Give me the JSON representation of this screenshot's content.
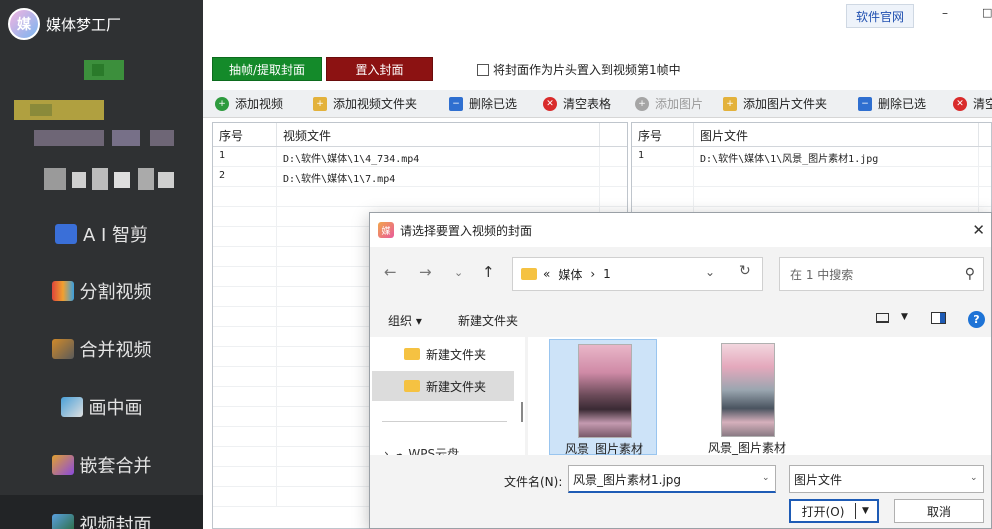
{
  "app": {
    "title": "媒体梦工厂",
    "logo_char": "媒"
  },
  "window": {
    "website_label": "软件官网",
    "minimize_glyph": "–",
    "maximize_glyph": "□"
  },
  "sidebar": {
    "items": [
      {
        "label": "A I 智剪",
        "icon": "ai-cut-icon",
        "color": "#3a6fd8"
      },
      {
        "label": "分割视频",
        "icon": "split-video-icon",
        "color": "#e0463a"
      },
      {
        "label": "合并视频",
        "icon": "merge-video-icon",
        "color": "#d08a2a"
      },
      {
        "label": "画中画",
        "icon": "picture-in-picture-icon",
        "color": "#4aa0d8"
      },
      {
        "label": "嵌套合并",
        "icon": "nested-merge-icon",
        "color": "#e0a030"
      },
      {
        "label": "视频封面",
        "icon": "video-cover-icon",
        "color": "#5aa0e0"
      }
    ]
  },
  "actions": {
    "extract_label": "抽帧/提取封面",
    "insert_label": "置入封面",
    "cover_checkbox_label": "将封面作为片头置入到视频第1帧中"
  },
  "toolbar": {
    "items": [
      {
        "label": "添加视频",
        "icon": "add-circle-icon",
        "color": "#2e9b3e"
      },
      {
        "label": "添加视频文件夹",
        "icon": "folder-add-icon",
        "color": "#e3b23c"
      },
      {
        "label": "删除已选",
        "icon": "delete-selected-icon",
        "color": "#2f6fd0"
      },
      {
        "label": "清空表格",
        "icon": "clear-icon",
        "color": "#d92b2b"
      },
      {
        "label": "添加图片",
        "icon": "add-circle-icon",
        "color": "#9a9a9a"
      },
      {
        "label": "添加图片文件夹",
        "icon": "folder-add-icon",
        "color": "#e3b23c"
      },
      {
        "label": "删除已选",
        "icon": "delete-selected-icon",
        "color": "#2f6fd0"
      },
      {
        "label": "清空",
        "icon": "clear-icon",
        "color": "#d92b2b"
      }
    ]
  },
  "video_table": {
    "headers": [
      "序号",
      "视频文件"
    ],
    "rows": [
      [
        "1",
        "D:\\软件\\媒体\\1\\4_734.mp4"
      ],
      [
        "2",
        "D:\\软件\\媒体\\1\\7.mp4"
      ]
    ]
  },
  "image_table": {
    "headers": [
      "序号",
      "图片文件"
    ],
    "rows": [
      [
        "1",
        "D:\\软件\\媒体\\1\\风景_图片素材1.jpg"
      ]
    ]
  },
  "dialog": {
    "title": "请选择要置入视频的封面",
    "address": {
      "prefix": "«",
      "parts": [
        "媒体",
        "›",
        "1"
      ]
    },
    "search_placeholder": "在 1 中搜索",
    "organize_label": "组织 ▾",
    "new_folder_label": "新建文件夹",
    "nav_folders": [
      {
        "label": "新建文件夹",
        "selected": false
      },
      {
        "label": "新建文件夹",
        "selected": true
      }
    ],
    "nav_extra": "›  ☁ WPS云盘",
    "files": [
      {
        "name": "风景_图片素材",
        "selected": true
      },
      {
        "name": "风景_图片素材",
        "selected": false
      }
    ],
    "filename_label": "文件名(N):",
    "filename_value": "风景_图片素材1.jpg",
    "filetype_value": "图片文件",
    "open_label": "打开(O)",
    "cancel_label": "取消"
  }
}
